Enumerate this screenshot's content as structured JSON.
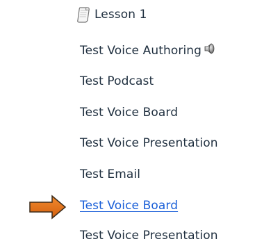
{
  "items": [
    {
      "label": "Lesson 1",
      "icon": "page-icon"
    },
    {
      "label": "Test Voice Authoring",
      "icon": "speaker-icon"
    },
    {
      "label": "Test Podcast"
    },
    {
      "label": "Test Voice Board"
    },
    {
      "label": "Test Voice Presentation"
    },
    {
      "label": "Test Email"
    },
    {
      "label": "Test Voice Board",
      "highlighted": true,
      "pointer": "arrow-right-icon"
    },
    {
      "label": "Test Voice Presentation"
    }
  ],
  "colors": {
    "text": "#1f2f3f",
    "link": "#1a5fd8",
    "arrow": "#e26a14"
  }
}
